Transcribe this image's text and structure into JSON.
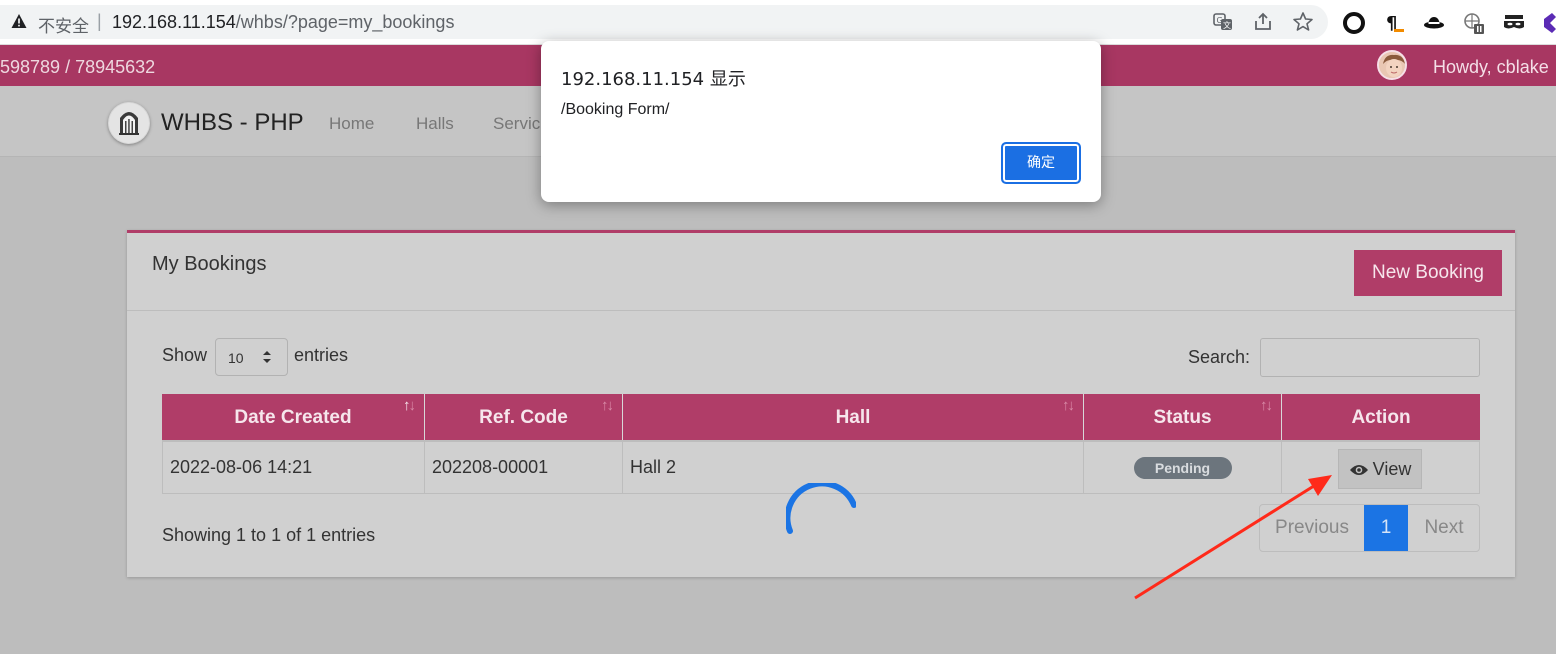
{
  "browser": {
    "insecure_label": "不安全",
    "separator": "|",
    "url_host": "192.168.11.154",
    "url_path": "/whbs/?page=my_bookings"
  },
  "topbar": {
    "phone": "598789 / 78945632",
    "greeting": "Howdy, cblake"
  },
  "navbar": {
    "brand": "WHBS - PHP",
    "links": [
      "Home",
      "Halls",
      "Servic"
    ]
  },
  "card": {
    "title": "My Bookings",
    "new_booking_label": "New Booking"
  },
  "controls": {
    "show_label": "Show",
    "page_size": "10",
    "entries_label": "entries",
    "search_label": "Search:",
    "search_value": ""
  },
  "table": {
    "columns": [
      "Date Created",
      "Ref. Code",
      "Hall",
      "Status",
      "Action"
    ],
    "rows": [
      {
        "date_created": "2022-08-06 14:21",
        "ref_code": "202208-00001",
        "hall": "Hall 2",
        "status": "Pending",
        "action": "View"
      }
    ]
  },
  "footer": {
    "info": "Showing 1 to 1 of 1 entries",
    "previous": "Previous",
    "current_page": "1",
    "next": "Next"
  },
  "dialog": {
    "title": "192.168.11.154 显示",
    "message": "/Booking Form/",
    "ok_label": "确定"
  },
  "colors": {
    "brand_pink": "#b03d68",
    "primary_blue": "#1b74e4",
    "badge_gray": "#6c757d",
    "arrow_red": "#ff2a1a"
  }
}
